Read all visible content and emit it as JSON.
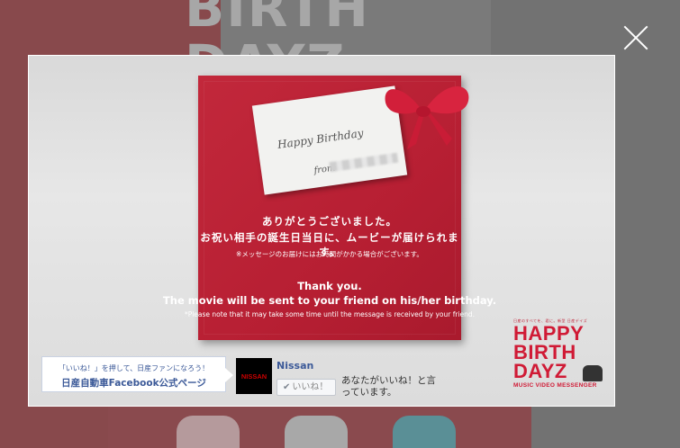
{
  "background": {
    "title_line1": "BIRTH",
    "title_line2": "DAYZ"
  },
  "close_label": "×",
  "card": {
    "title": "Happy Birthday",
    "from_prefix": "from"
  },
  "message": {
    "ja_line1": "ありがとうございました。",
    "ja_line2": "お祝い相手の誕生日当日に、ムービーが届けられます。",
    "ja_note": "※メッセージのお届けにはお時間がかかる場合がございます。",
    "en_line1": "Thank you.",
    "en_line2": "The movie will be sent to your friend on his/her birthday.",
    "en_note": "*Please note that it may take some time until the message is received by your friend."
  },
  "logo": {
    "tagline": "日産のすべてを、君に。新型 日産デイズ",
    "line1": "HAPPY",
    "line2": "BIRTH",
    "line3": "DAYZ",
    "subtitle": "MUSIC VIDEO MESSENGER"
  },
  "facebook": {
    "banner_line1": "「いいね！」を押して、日産ファンになろう！",
    "banner_line2": "日産自動車Facebook公式ページ",
    "logo_text": "NISSAN",
    "page_name": "Nissan",
    "like_label": "いいね！",
    "like_text": "あなたがいいね！と言っています。"
  },
  "colors": {
    "brand_red": "#d01a35",
    "box_red": "#b71f33",
    "facebook_blue": "#3b5998"
  }
}
